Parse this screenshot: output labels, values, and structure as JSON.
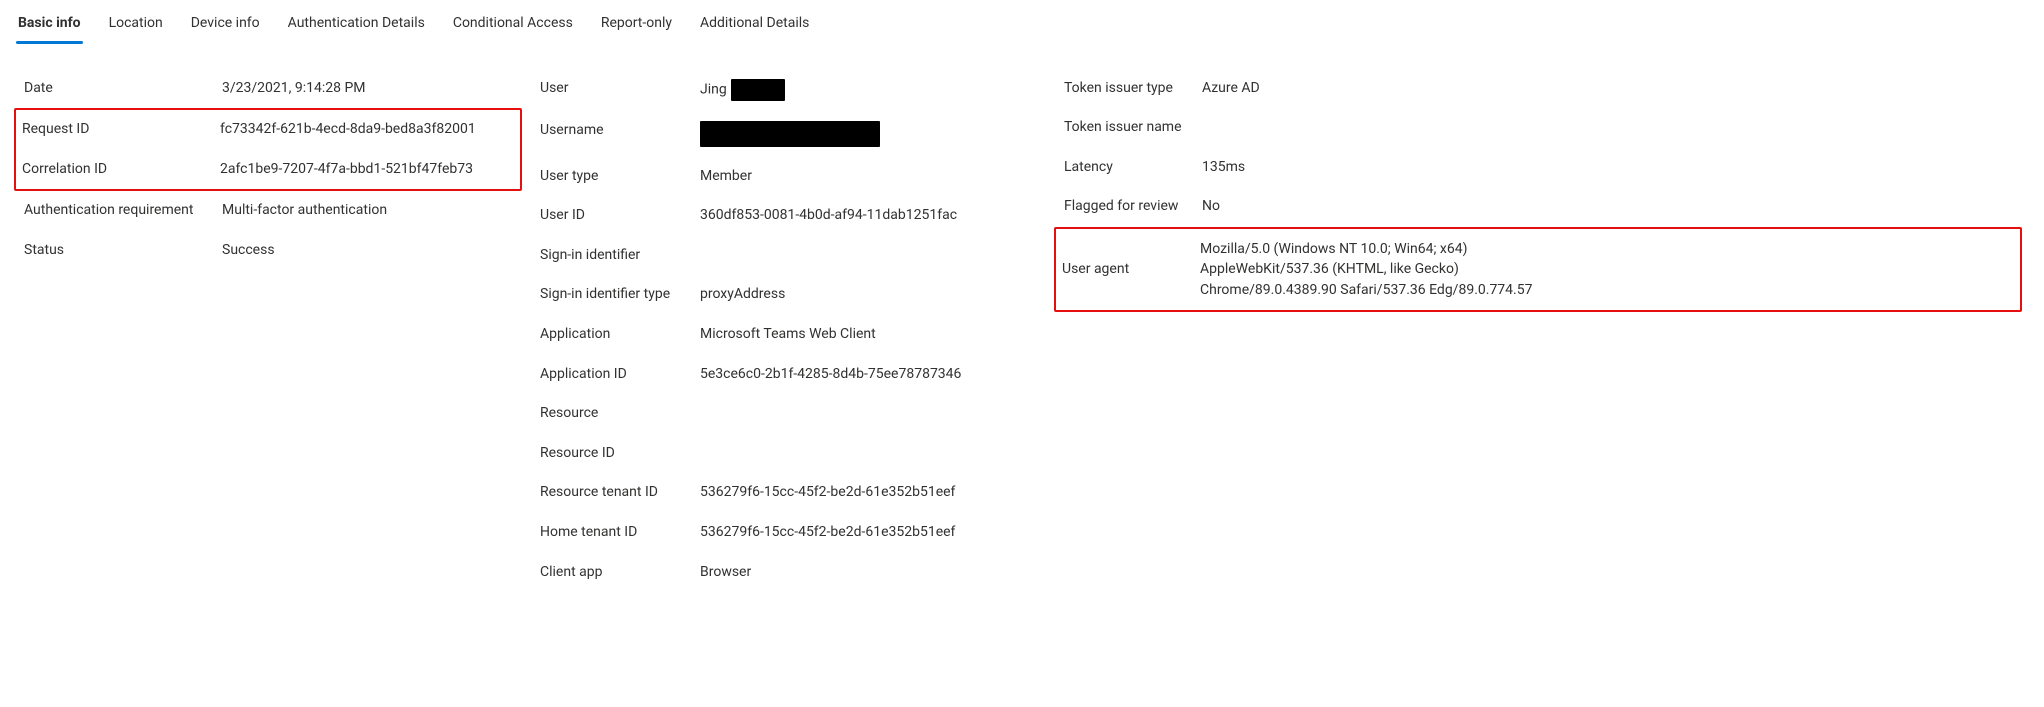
{
  "tabs": {
    "basic_info": "Basic info",
    "location": "Location",
    "device_info": "Device info",
    "auth_details": "Authentication Details",
    "conditional_access": "Conditional Access",
    "report_only": "Report-only",
    "additional_details": "Additional Details"
  },
  "col1": {
    "date": {
      "label": "Date",
      "value": "3/23/2021, 9:14:28 PM"
    },
    "request_id": {
      "label": "Request ID",
      "value": "fc73342f-621b-4ecd-8da9-bed8a3f82001"
    },
    "correlation_id": {
      "label": "Correlation ID",
      "value": "2afc1be9-7207-4f7a-bbd1-521bf47feb73"
    },
    "auth_requirement": {
      "label": "Authentication requirement",
      "value": "Multi-factor authentication"
    },
    "status": {
      "label": "Status",
      "value": "Success"
    }
  },
  "col2": {
    "user": {
      "label": "User",
      "value_visible": "Jing"
    },
    "username": {
      "label": "Username"
    },
    "user_type": {
      "label": "User type",
      "value": "Member"
    },
    "user_id": {
      "label": "User ID",
      "value": "360df853-0081-4b0d-af94-11dab1251fac"
    },
    "signin_identifier": {
      "label": "Sign-in identifier",
      "value": ""
    },
    "signin_identifier_type": {
      "label": "Sign-in identifier type",
      "value": "proxyAddress"
    },
    "application": {
      "label": "Application",
      "value": "Microsoft Teams Web Client"
    },
    "application_id": {
      "label": "Application ID",
      "value": "5e3ce6c0-2b1f-4285-8d4b-75ee78787346"
    },
    "resource": {
      "label": "Resource",
      "value": ""
    },
    "resource_id": {
      "label": "Resource ID",
      "value": ""
    },
    "resource_tenant_id": {
      "label": "Resource tenant ID",
      "value": "536279f6-15cc-45f2-be2d-61e352b51eef"
    },
    "home_tenant_id": {
      "label": "Home tenant ID",
      "value": "536279f6-15cc-45f2-be2d-61e352b51eef"
    },
    "client_app": {
      "label": "Client app",
      "value": "Browser"
    }
  },
  "col3": {
    "token_issuer_type": {
      "label": "Token issuer type",
      "value": "Azure AD"
    },
    "token_issuer_name": {
      "label": "Token issuer name",
      "value": ""
    },
    "latency": {
      "label": "Latency",
      "value": "135ms"
    },
    "flagged_for_review": {
      "label": "Flagged for review",
      "value": "No"
    },
    "user_agent": {
      "label": "User agent",
      "value": "Mozilla/5.0 (Windows NT 10.0; Win64; x64) AppleWebKit/537.36 (KHTML, like Gecko) Chrome/89.0.4389.90 Safari/537.36 Edg/89.0.774.57"
    }
  }
}
